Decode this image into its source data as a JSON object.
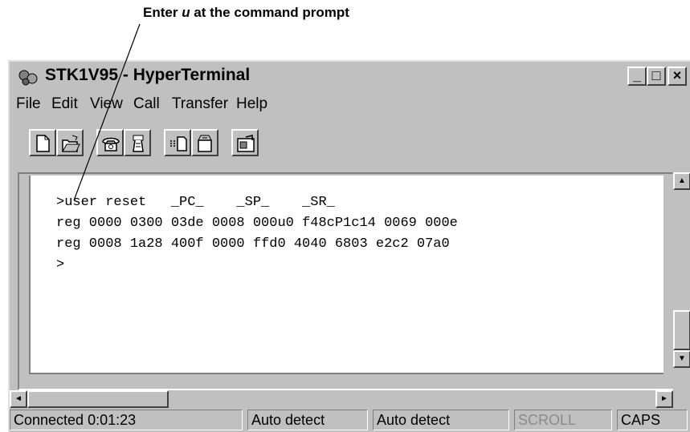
{
  "annotation": {
    "text_prefix": "Enter ",
    "text_var": "u",
    "text_suffix": " at the command prompt"
  },
  "window": {
    "title": "STK1V95 - HyperTerminal",
    "buttons": {
      "minimize": "_",
      "maximize": "□",
      "close": "×"
    }
  },
  "menu": {
    "items": [
      "File",
      "Edit",
      "View",
      "Call",
      "Transfer",
      "Help"
    ]
  },
  "toolbar": {
    "buttons": [
      "new-icon",
      "open-icon",
      "connect-icon",
      "disconnect-icon",
      "send-icon",
      "receive-icon",
      "properties-icon"
    ]
  },
  "terminal": {
    "lines": [
      ">user reset   _PC_    _SP_    _SR_",
      "reg 0000 0300 03de 0008 000u0 f48cP1c14 0069 000e",
      "reg 0008 1a28 400f 0000 ffd0 4040 6803 e2c2 07a0",
      ">"
    ]
  },
  "scrollbar": {
    "up": "▲",
    "down": "▼",
    "left": "◄",
    "right": "►"
  },
  "status": {
    "connected": "Connected 0:01:23",
    "detect1": "Auto detect",
    "detect2": "Auto detect",
    "scroll": "SCROLL",
    "caps": "CAPS"
  }
}
